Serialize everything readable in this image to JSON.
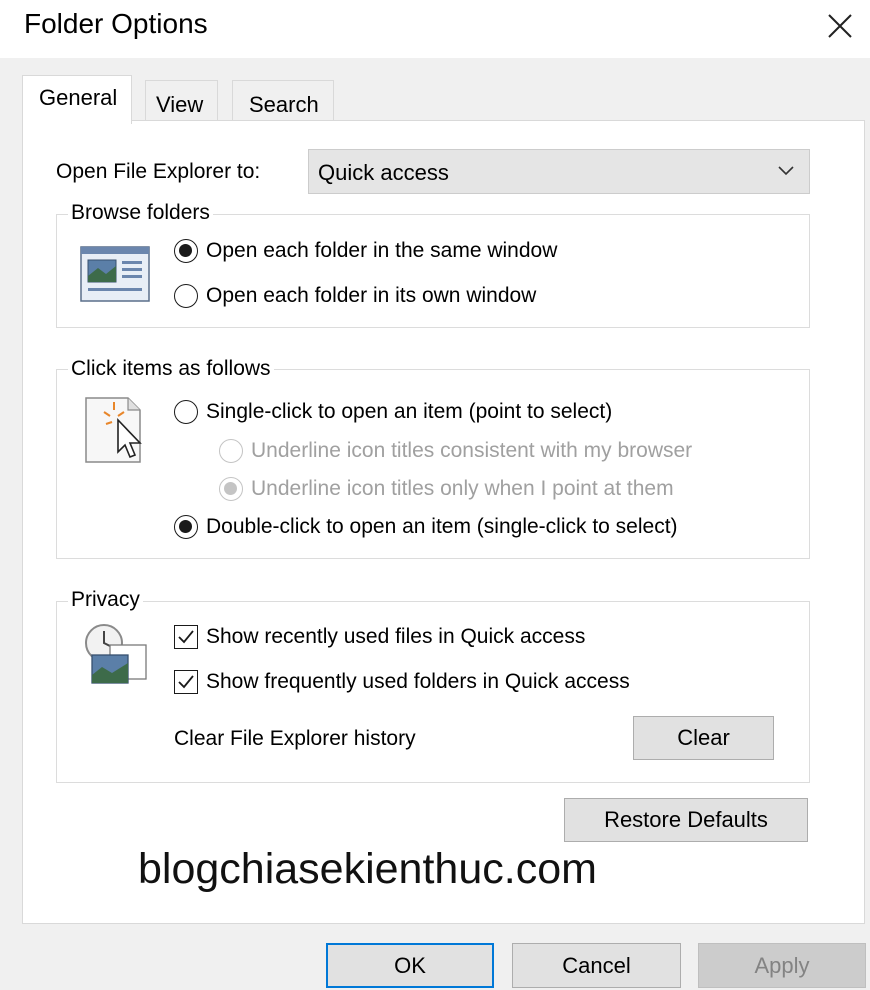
{
  "window": {
    "title": "Folder Options"
  },
  "tabs": [
    {
      "label": "General",
      "active": true
    },
    {
      "label": "View",
      "active": false
    },
    {
      "label": "Search",
      "active": false
    }
  ],
  "open_to": {
    "label": "Open File Explorer to:",
    "value": "Quick access"
  },
  "browse": {
    "legend": "Browse folders",
    "options": [
      {
        "label": "Open each folder in the same window",
        "checked": true
      },
      {
        "label": "Open each folder in its own window",
        "checked": false
      }
    ]
  },
  "click": {
    "legend": "Click items as follows",
    "single": {
      "label": "Single-click to open an item (point to select)",
      "checked": false
    },
    "underline_browser": {
      "label": "Underline icon titles consistent with my browser",
      "checked": false,
      "disabled": true
    },
    "underline_point": {
      "label": "Underline icon titles only when I point at them",
      "checked": true,
      "disabled": true
    },
    "double": {
      "label": "Double-click to open an item (single-click to select)",
      "checked": true
    }
  },
  "privacy": {
    "legend": "Privacy",
    "recent_files": {
      "label": "Show recently used files in Quick access",
      "checked": true
    },
    "frequent_folders": {
      "label": "Show frequently used folders in Quick access",
      "checked": true
    },
    "clear_label": "Clear File Explorer history",
    "clear_button": "Clear"
  },
  "restore_button": "Restore Defaults",
  "watermark": "blogchiasekienthuc.com",
  "footer": {
    "ok": "OK",
    "cancel": "Cancel",
    "apply": "Apply"
  },
  "colors": {
    "accent": "#0078d7",
    "dialog_bg": "#f0f0f0",
    "disabled_text": "#a0a0a0"
  }
}
